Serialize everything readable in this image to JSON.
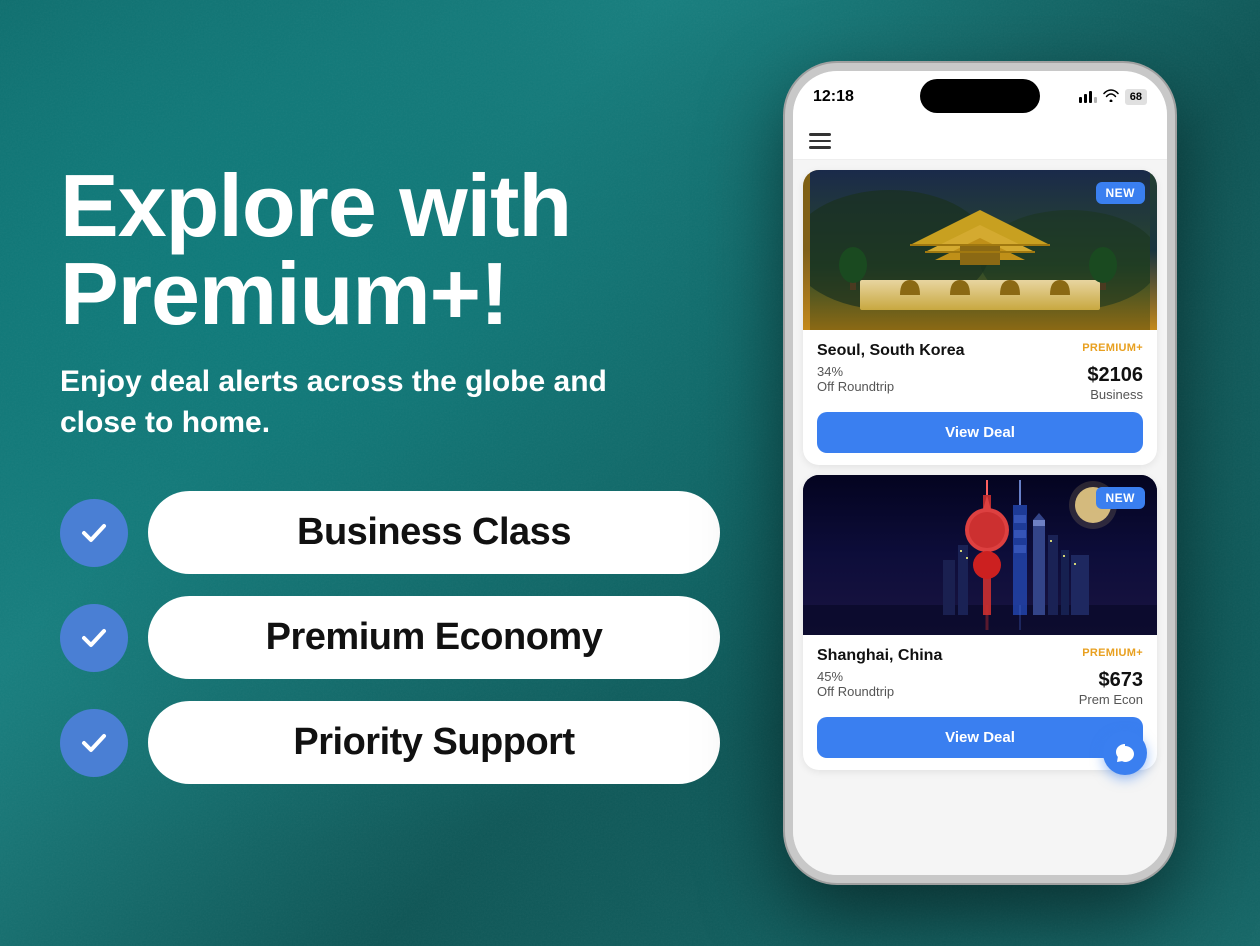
{
  "hero": {
    "title": "Explore with Premium+!",
    "subtitle": "Enjoy deal alerts across the globe and close to home."
  },
  "features": [
    {
      "id": "business-class",
      "label": "Business Class"
    },
    {
      "id": "premium-economy",
      "label": "Premium Economy"
    },
    {
      "id": "priority-support",
      "label": "Priority Support"
    }
  ],
  "phone": {
    "time": "12:18",
    "battery": "68",
    "nav_icon": "menu",
    "deals": [
      {
        "id": "seoul",
        "city": "Seoul, South Korea",
        "badge": "PREMIUM+",
        "new_label": "NEW",
        "discount": "34%",
        "discount_label": "Off Roundtrip",
        "price": "$2106",
        "class": "Business",
        "button_label": "View Deal"
      },
      {
        "id": "shanghai",
        "city": "Shanghai, China",
        "badge": "PREMIUM+",
        "new_label": "NEW",
        "discount": "45%",
        "discount_label": "Off Roundtrip",
        "price": "$673",
        "class": "Prem Econ",
        "button_label": "View Deal"
      }
    ]
  },
  "colors": {
    "accent_blue": "#3a7ff0",
    "check_blue": "#4a7fd0",
    "premium_gold": "#e8a020",
    "background_teal": "#147070"
  }
}
